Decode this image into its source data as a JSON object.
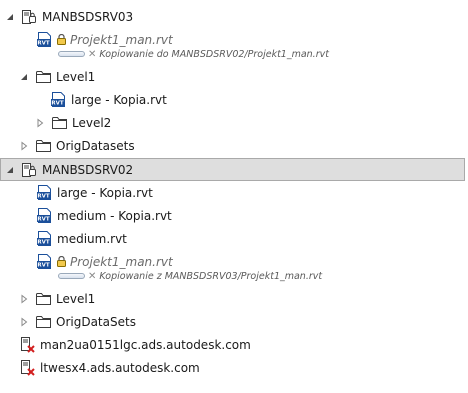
{
  "tree": {
    "server1": {
      "name": "MANBSDSRV03"
    },
    "s1_file": {
      "name": "Projekt1_man.rvt",
      "status": "Kopiowanie do MANBSDSRV02/Projekt1_man.rvt"
    },
    "s1_level1": {
      "name": "Level1"
    },
    "s1_level1_file": {
      "name": "large - Kopia.rvt"
    },
    "s1_level2": {
      "name": "Level2"
    },
    "s1_orig": {
      "name": "OrigDatasets"
    },
    "server2": {
      "name": "MANBSDSRV02"
    },
    "s2_file1": {
      "name": "large - Kopia.rvt"
    },
    "s2_file2": {
      "name": "medium - Kopia.rvt"
    },
    "s2_file3": {
      "name": "medium.rvt"
    },
    "s2_file4": {
      "name": "Projekt1_man.rvt",
      "status": "Kopiowanie z MANBSDSRV03/Projekt1_man.rvt"
    },
    "s2_level1": {
      "name": "Level1"
    },
    "s2_orig": {
      "name": "OrigDataSets"
    },
    "host1": {
      "name": "man2ua0151lgc.ads.autodesk.com"
    },
    "host2": {
      "name": "ltwesx4.ads.autodesk.com"
    }
  },
  "icons": {
    "server": "server-icon",
    "server_offline": "server-offline-icon",
    "folder": "folder-icon",
    "rvt": "rvt-file-icon",
    "lock": "lock-icon",
    "expanded": "triangle-expanded-icon",
    "collapsed": "triangle-collapsed-icon"
  },
  "colors": {
    "selected_bg": "#dedede",
    "selected_border": "#a9a9a9",
    "rvt_blue": "#1b4f9a",
    "offline_red": "#d21f1f"
  }
}
